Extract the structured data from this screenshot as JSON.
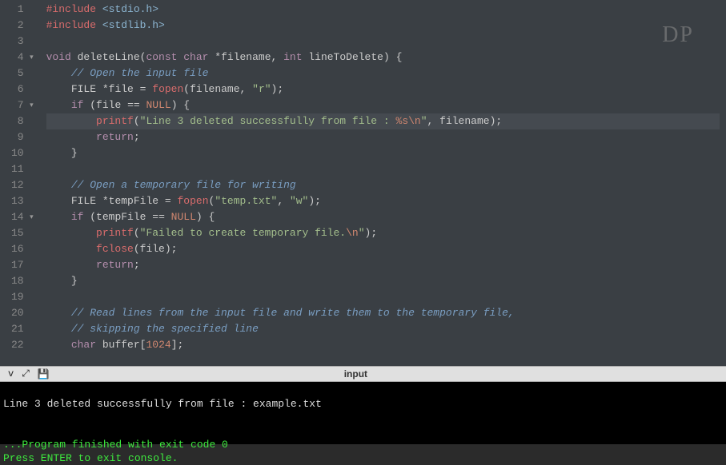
{
  "watermark": "DP",
  "editor": {
    "lines": [
      {
        "num": "1",
        "fold": "",
        "hl": false,
        "tokens": [
          [
            "kw-pp",
            "#include "
          ],
          [
            "kw-inc",
            "<stdio.h>"
          ]
        ]
      },
      {
        "num": "2",
        "fold": "",
        "hl": false,
        "tokens": [
          [
            "kw-pp",
            "#include "
          ],
          [
            "kw-inc",
            "<stdlib.h>"
          ]
        ]
      },
      {
        "num": "3",
        "fold": "",
        "hl": false,
        "tokens": []
      },
      {
        "num": "4",
        "fold": "▾",
        "hl": false,
        "tokens": [
          [
            "kw-type",
            "void "
          ],
          [
            "id",
            "deleteLine"
          ],
          [
            "op",
            "("
          ],
          [
            "kw-type",
            "const char "
          ],
          [
            "op",
            "*"
          ],
          [
            "id",
            "filename"
          ],
          [
            "op",
            ", "
          ],
          [
            "kw-type",
            "int "
          ],
          [
            "id",
            "lineToDelete"
          ],
          [
            "op",
            ") {"
          ]
        ]
      },
      {
        "num": "5",
        "fold": "",
        "hl": false,
        "tokens": [
          [
            "op",
            "    "
          ],
          [
            "cmt",
            "// Open the input file"
          ]
        ]
      },
      {
        "num": "6",
        "fold": "",
        "hl": false,
        "tokens": [
          [
            "op",
            "    "
          ],
          [
            "id",
            "FILE "
          ],
          [
            "op",
            "*"
          ],
          [
            "id",
            "file "
          ],
          [
            "op",
            "= "
          ],
          [
            "fn",
            "fopen"
          ],
          [
            "op",
            "("
          ],
          [
            "id",
            "filename"
          ],
          [
            "op",
            ", "
          ],
          [
            "str",
            "\"r\""
          ],
          [
            "op",
            ");"
          ]
        ]
      },
      {
        "num": "7",
        "fold": "▾",
        "hl": false,
        "tokens": [
          [
            "op",
            "    "
          ],
          [
            "kw",
            "if "
          ],
          [
            "op",
            "("
          ],
          [
            "id",
            "file "
          ],
          [
            "op",
            "== "
          ],
          [
            "null",
            "NULL"
          ],
          [
            "op",
            ") {"
          ]
        ]
      },
      {
        "num": "8",
        "fold": "",
        "hl": true,
        "tokens": [
          [
            "op",
            "        "
          ],
          [
            "fn",
            "printf"
          ],
          [
            "op",
            "("
          ],
          [
            "str",
            "\"Line 3 deleted successfully from file : "
          ],
          [
            "esc",
            "%s\\n"
          ],
          [
            "str",
            "\""
          ],
          [
            "op",
            ", "
          ],
          [
            "id",
            "filename"
          ],
          [
            "op",
            ");"
          ]
        ]
      },
      {
        "num": "9",
        "fold": "",
        "hl": false,
        "tokens": [
          [
            "op",
            "        "
          ],
          [
            "kw",
            "return"
          ],
          [
            "op",
            ";"
          ]
        ]
      },
      {
        "num": "10",
        "fold": "",
        "hl": false,
        "tokens": [
          [
            "op",
            "    }"
          ]
        ]
      },
      {
        "num": "11",
        "fold": "",
        "hl": false,
        "tokens": []
      },
      {
        "num": "12",
        "fold": "",
        "hl": false,
        "tokens": [
          [
            "op",
            "    "
          ],
          [
            "cmt",
            "// Open a temporary file for writing"
          ]
        ]
      },
      {
        "num": "13",
        "fold": "",
        "hl": false,
        "tokens": [
          [
            "op",
            "    "
          ],
          [
            "id",
            "FILE "
          ],
          [
            "op",
            "*"
          ],
          [
            "id",
            "tempFile "
          ],
          [
            "op",
            "= "
          ],
          [
            "fn",
            "fopen"
          ],
          [
            "op",
            "("
          ],
          [
            "str",
            "\"temp.txt\""
          ],
          [
            "op",
            ", "
          ],
          [
            "str",
            "\"w\""
          ],
          [
            "op",
            ");"
          ]
        ]
      },
      {
        "num": "14",
        "fold": "▾",
        "hl": false,
        "tokens": [
          [
            "op",
            "    "
          ],
          [
            "kw",
            "if "
          ],
          [
            "op",
            "("
          ],
          [
            "id",
            "tempFile "
          ],
          [
            "op",
            "== "
          ],
          [
            "null",
            "NULL"
          ],
          [
            "op",
            ") {"
          ]
        ]
      },
      {
        "num": "15",
        "fold": "",
        "hl": false,
        "tokens": [
          [
            "op",
            "        "
          ],
          [
            "fn",
            "printf"
          ],
          [
            "op",
            "("
          ],
          [
            "str",
            "\"Failed to create temporary file."
          ],
          [
            "esc",
            "\\n"
          ],
          [
            "str",
            "\""
          ],
          [
            "op",
            ");"
          ]
        ]
      },
      {
        "num": "16",
        "fold": "",
        "hl": false,
        "tokens": [
          [
            "op",
            "        "
          ],
          [
            "fn",
            "fclose"
          ],
          [
            "op",
            "("
          ],
          [
            "id",
            "file"
          ],
          [
            "op",
            ");"
          ]
        ]
      },
      {
        "num": "17",
        "fold": "",
        "hl": false,
        "tokens": [
          [
            "op",
            "        "
          ],
          [
            "kw",
            "return"
          ],
          [
            "op",
            ";"
          ]
        ]
      },
      {
        "num": "18",
        "fold": "",
        "hl": false,
        "tokens": [
          [
            "op",
            "    }"
          ]
        ]
      },
      {
        "num": "19",
        "fold": "",
        "hl": false,
        "tokens": []
      },
      {
        "num": "20",
        "fold": "",
        "hl": false,
        "tokens": [
          [
            "op",
            "    "
          ],
          [
            "cmt",
            "// Read lines from the input file and write them to the temporary file,"
          ]
        ]
      },
      {
        "num": "21",
        "fold": "",
        "hl": false,
        "tokens": [
          [
            "op",
            "    "
          ],
          [
            "cmt",
            "// skipping the specified line"
          ]
        ]
      },
      {
        "num": "22",
        "fold": "",
        "hl": false,
        "tokens": [
          [
            "op",
            "    "
          ],
          [
            "kw-type",
            "char "
          ],
          [
            "id",
            "buffer"
          ],
          [
            "op",
            "["
          ],
          [
            "num",
            "1024"
          ],
          [
            "op",
            "];"
          ]
        ]
      }
    ]
  },
  "toolbar": {
    "title": "input",
    "icons": {
      "collapse": "v",
      "expand": "⤢",
      "save": "💾"
    }
  },
  "console": {
    "line1": "Line 3 deleted successfully from file : example.txt",
    "blank": "",
    "line2": "...Program finished with exit code 0",
    "line3": "Press ENTER to exit console."
  }
}
